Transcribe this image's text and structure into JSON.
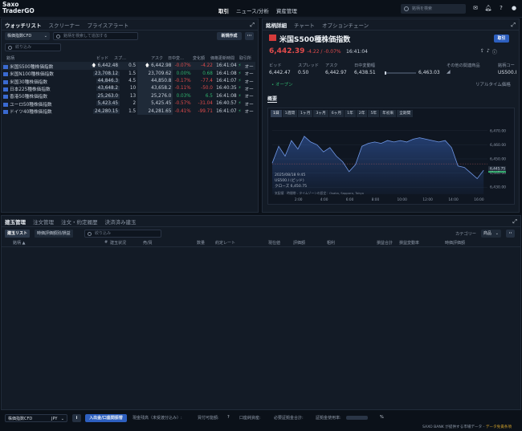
{
  "app": {
    "title_line1": "Saxo",
    "title_line2": "TraderGO"
  },
  "topnav": [
    {
      "label": "取引",
      "active": true
    },
    {
      "label": "ニュース/分析"
    },
    {
      "label": "資産管理"
    }
  ],
  "global_search": {
    "placeholder": "銘柄を検索"
  },
  "topicons": [
    "mail-icon",
    "bell-icon",
    "help-icon",
    "user-icon"
  ],
  "watchlist": {
    "tabs": [
      "ウォッチリスト",
      "スクリーナー",
      "プライスアラート"
    ],
    "list_select": "株価指数CFD",
    "search_placeholder": "銘柄を検索して追加する",
    "new_button": "新規作成",
    "more": "···",
    "filter_placeholder": "絞り込み",
    "columns": [
      "銘柄",
      "ビッド",
      "スプ…",
      "アスク",
      "日中変…",
      "変化額",
      "価格更新時間",
      "取引所"
    ],
    "rows": [
      {
        "name": "米国S500種株価指数",
        "bid": "6,442.48",
        "spread": "0.5",
        "ask": "6,442.98",
        "pct": "-0.07%",
        "chg": "-4.22",
        "time": "16:41:04",
        "ex": "オー",
        "up": true
      },
      {
        "name": "米国N100種株価指数",
        "bid": "23,708.12",
        "spread": "1.5",
        "ask": "23,709.62",
        "pct": "0.00%",
        "chg": "0.68",
        "time": "16:41:08",
        "ex": "オー"
      },
      {
        "name": "米国30種株価指数",
        "bid": "44,846.3",
        "spread": "4.5",
        "ask": "44,850.8",
        "pct": "-0.17%",
        "chg": "-77.4",
        "time": "16:41:07",
        "ex": "オー"
      },
      {
        "name": "日本225種株価指数",
        "bid": "43,648.2",
        "spread": "10",
        "ask": "43,658.2",
        "pct": "-0.11%",
        "chg": "-50.0",
        "time": "16:40:35",
        "ex": "オー"
      },
      {
        "name": "香港50種株価指数",
        "bid": "25,263.0",
        "spread": "13",
        "ask": "25,276.0",
        "pct": "0.03%",
        "chg": "6.5",
        "time": "16:41:08",
        "ex": "オー"
      },
      {
        "name": "ユーロ50種株価指数",
        "bid": "5,423.45",
        "spread": "2",
        "ask": "5,425.45",
        "pct": "-0.57%",
        "chg": "-31.04",
        "time": "16:40:57",
        "ex": "オー"
      },
      {
        "name": "ドイツ40種株価指数",
        "bid": "24,280.15",
        "spread": "1.5",
        "ask": "24,281.65",
        "pct": "-0.41%",
        "chg": "-99.71",
        "time": "16:41:07",
        "ex": "オー"
      }
    ]
  },
  "detail": {
    "tabs": [
      "銘柄詳細",
      "チャート",
      "オプションチェーン"
    ],
    "badge": "CFD",
    "name": "米国S500種株価指数",
    "trade_button": "取引",
    "price": "6,442.39",
    "change": "-4.22 / -0.07%",
    "time": "16:41:04",
    "labels": {
      "bid": "ビッド",
      "spread": "スプレッド",
      "ask": "アスク",
      "range": "日中変動幅",
      "related": "その他の関連商品",
      "code": "銘柄コー"
    },
    "bid": "6,442.47",
    "spread": "0.50",
    "ask": "6,442.97",
    "low": "6,438.51",
    "high": "6,463.03",
    "code": "US500.I",
    "open_status": "• オープン",
    "realtime": "リアルタイム価格",
    "overview": "概要"
  },
  "chart": {
    "periods": [
      "1日",
      "1週間",
      "1ヶ月",
      "3ヶ月",
      "6ヶ月",
      "1年",
      "2年",
      "5年",
      "年初来",
      "全期間"
    ],
    "active_period": "1日",
    "info_date": "2025/08/18 9:45",
    "info_series": "US500.I (ビッド)",
    "info_close": "クローズ 6,450.75",
    "footnote": "気配値　時間帯 - タイムゾーンの設定：Osaka, Sapporo, Tokyo",
    "last_label": "6,442.47",
    "ref_label": "6,445.75"
  },
  "chart_data": {
    "type": "line",
    "x_ticks": [
      "2:00",
      "4:00",
      "6:00",
      "8:00",
      "10:00",
      "12:00",
      "14:00",
      "16:00"
    ],
    "y_ticks": [
      "6,470.00",
      "6,460.00",
      "6,450.00",
      "6,440.00",
      "6,430.00"
    ],
    "ylim": [
      6425,
      6475
    ],
    "x": [
      0,
      0.5,
      1,
      1.5,
      2,
      2.5,
      3,
      3.5,
      4,
      4.5,
      5,
      5.5,
      6,
      6.5,
      7,
      7.5,
      8,
      8.5,
      9,
      9.5,
      10,
      10.5,
      11,
      11.5,
      12,
      12.5,
      13,
      13.5,
      14,
      14.5,
      15,
      15.5,
      16,
      16.5
    ],
    "values": [
      6447,
      6459,
      6452,
      6463,
      6457,
      6466,
      6462,
      6460,
      6455,
      6458,
      6452,
      6448,
      6441,
      6446,
      6459,
      6461,
      6462,
      6461,
      6463,
      6462,
      6463,
      6462,
      6464,
      6465,
      6464,
      6463,
      6462,
      6463,
      6458,
      6445,
      6444,
      6440,
      6436,
      6442
    ]
  },
  "positions": {
    "tabs": [
      "建玉管理",
      "注文管理",
      "注文・約定履歴",
      "決済済み建玉"
    ],
    "sub_tabs": [
      "建玉リスト",
      "時価評価額別/損益"
    ],
    "filter_placeholder": "絞り込み",
    "category_label": "カテゴリー",
    "category_value": "商品",
    "columns": [
      "銘柄 ▲",
      "#",
      "建玉状況",
      "売/買",
      "数量",
      "約定レート",
      "現在値",
      "評価額",
      "粗利",
      "損益合計",
      "損益変動率",
      "時価評価額"
    ]
  },
  "footer": {
    "account": "株価指数CFD",
    "currency": "JPY",
    "deposit_button": "入出金/口座間振替",
    "labels": [
      "現金残高（未受渡分込み）:",
      "買付可能額:",
      "口座純資産:",
      "必要証拠金合計:",
      "証拠金使用率:"
    ],
    "pct": "%",
    "credit_prefix": "SAXO BANK が提供する市場データ -",
    "credit_link": "データ免責条項"
  }
}
